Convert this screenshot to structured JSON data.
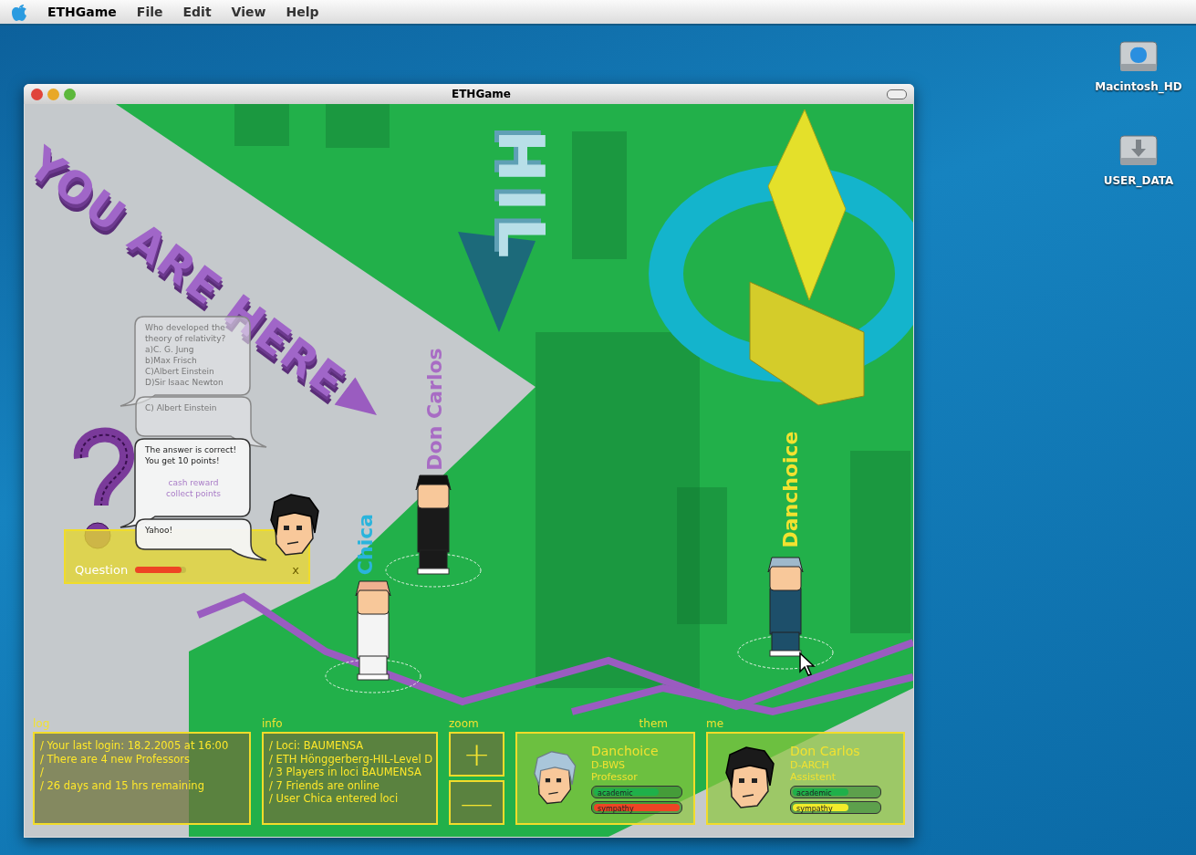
{
  "menu_bar": {
    "app": "ETHGame",
    "items": [
      "File",
      "Edit",
      "View",
      "Help"
    ]
  },
  "desktop_icons": [
    {
      "label": "Macintosh_HD",
      "kind": "hd"
    },
    {
      "label": "USER_DATA",
      "kind": "download"
    }
  ],
  "window": {
    "title": "ETHGame"
  },
  "scene": {
    "banner": "YOU ARE HERE",
    "sign": "HIL",
    "players": [
      {
        "name": "Don Carlos",
        "color": "#a86cc4"
      },
      {
        "name": "Chica",
        "color": "#2ab4dc"
      },
      {
        "name": "Danchoice",
        "color": "#f2e230"
      }
    ]
  },
  "chat": [
    {
      "faded": true,
      "lines": [
        "Who developed the",
        "theory of relativity?",
        "a)C. G. Jung",
        "b)Max Frisch",
        "C)Albert Einstein",
        "D)Sir Isaac Newton"
      ]
    },
    {
      "faded": true,
      "lines": [
        "C) Albert Einstein"
      ]
    },
    {
      "faded": false,
      "lines": [
        "The answer is correct!",
        "You get 10 points!"
      ],
      "links": [
        "cash reward",
        "collect points"
      ]
    },
    {
      "faded": false,
      "lines": [
        "Yahoo!"
      ]
    }
  ],
  "question_panel": {
    "label": "Question",
    "level": 0.9,
    "close": "x"
  },
  "hud": {
    "log": {
      "title": "log",
      "lines": [
        "/ Your last login: 18.2.2005 at 16:00",
        "/ There are 4 new Professors",
        "/",
        "/ 26 days and 15 hrs remaining"
      ]
    },
    "info": {
      "title": "info",
      "lines": [
        "/ Loci: BAUMENSA",
        "/ ETH Hönggerberg-HIL-Level D",
        "/ 3 Players in loci BAUMENSA",
        "/ 7 Friends are online",
        "/ User Chica entered loci"
      ]
    },
    "zoom": {
      "title": "zoom",
      "buttons": [
        "+",
        "—"
      ]
    },
    "cards": [
      {
        "heading": "them",
        "name": "Danchoice",
        "department": "D-BWS",
        "role": "Professor",
        "bars": [
          {
            "label": "academic",
            "level": 0.75,
            "color": "#1fb04a"
          },
          {
            "label": "sympathy",
            "level": 1,
            "color": "#ee4424"
          }
        ]
      },
      {
        "heading": "me",
        "name": "Don Carlos",
        "department": "D-ARCH",
        "role": "Assistent",
        "bars": [
          {
            "label": "academic",
            "level": 0.65,
            "color": "#1fb04a"
          },
          {
            "label": "sympathy",
            "level": 0.65,
            "color": "#f2ec2a"
          }
        ]
      }
    ]
  }
}
